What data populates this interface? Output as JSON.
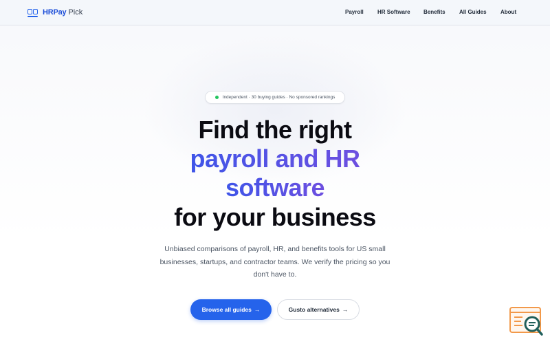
{
  "header": {
    "logo_strong": "HRPay",
    "logo_light": "Pick",
    "nav": [
      "Payroll",
      "HR Software",
      "Benefits",
      "All Guides",
      "About"
    ]
  },
  "hero": {
    "badge": "Independent · 30 buying guides · No sponsored rankings",
    "headline": {
      "line1": "Find the right",
      "line2": "payroll and HR",
      "line3": "software",
      "line4": "for your business"
    },
    "subtext": "Unbiased comparisons of payroll, HR, and benefits tools for US small businesses, startups, and contractor teams. We verify the pricing so you don't have to.",
    "primary_button": "Browse all guides",
    "primary_arrow": "→",
    "secondary_button": "Gusto alternatives",
    "secondary_arrow": "→"
  },
  "colors": {
    "brand": "#2563eb",
    "accent_gradient_start": "#3f55e8",
    "accent_gradient_end": "#6d4fe0",
    "status_dot": "#22c55e",
    "widget_orange": "#f2994a",
    "widget_teal": "#1f5f5b"
  },
  "icons": {
    "logo": "hrpay-logo-icon",
    "status": "status-dot-icon",
    "widget": "search-document-icon"
  }
}
